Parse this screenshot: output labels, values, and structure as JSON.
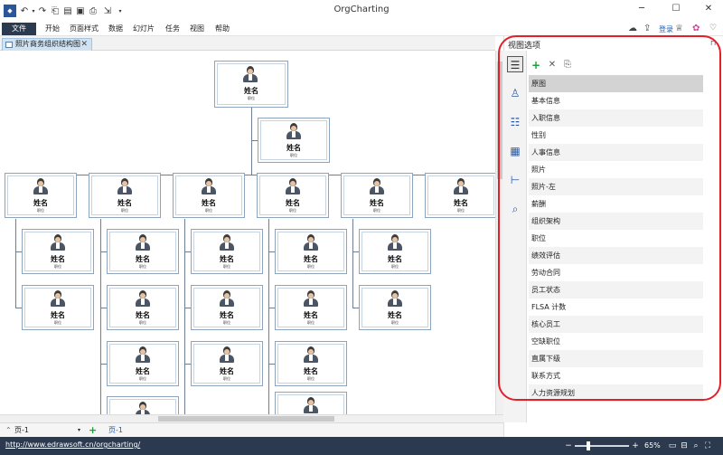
{
  "app": {
    "title": "OrgCharting"
  },
  "quick_access": {
    "icons": [
      "app-logo-icon",
      "undo-icon",
      "undo-dropdown-icon",
      "redo-icon",
      "new-icon",
      "open-icon",
      "save-icon",
      "print-icon",
      "export-icon",
      "customize-icon"
    ]
  },
  "window_controls": {
    "minimize": "─",
    "maximize": "☐",
    "close": "✕"
  },
  "account": {
    "login_label": "登录"
  },
  "menu": {
    "file": "文件",
    "items": [
      "开始",
      "页面样式",
      "数据",
      "幻灯片",
      "任务",
      "视图",
      "帮助"
    ]
  },
  "document_tab": {
    "label": "照片商务组织结构图",
    "close": "✕"
  },
  "chart": {
    "node_name": "姓名",
    "node_position": "职位"
  },
  "page_tabs": {
    "current_page": "页-1",
    "active_tab": "页-1",
    "add": "+"
  },
  "side_panel": {
    "title": "视图选项",
    "pin": "⊓",
    "toolbar": {
      "add": "+",
      "delete": "✕",
      "copy": "⎘"
    },
    "views": [
      "原图",
      "基本信息",
      "入职信息",
      "性别",
      "人事信息",
      "照片",
      "照片-左",
      "薪酬",
      "组织架构",
      "职位",
      "绩效评估",
      "劳动合同",
      "员工状态",
      "FLSA 计数",
      "核心员工",
      "空缺职位",
      "直属下级",
      "联系方式",
      "人力资源规划"
    ],
    "selected_view": "原图"
  },
  "status": {
    "url": "http://www.edrawsoft.cn/orgcharting/",
    "zoom": "65%",
    "zoom_minus": "−",
    "zoom_plus": "+"
  },
  "colors": {
    "accent": "#2b3a4e",
    "highlight_ring": "#e3202a",
    "login": "#1d5fb5"
  }
}
